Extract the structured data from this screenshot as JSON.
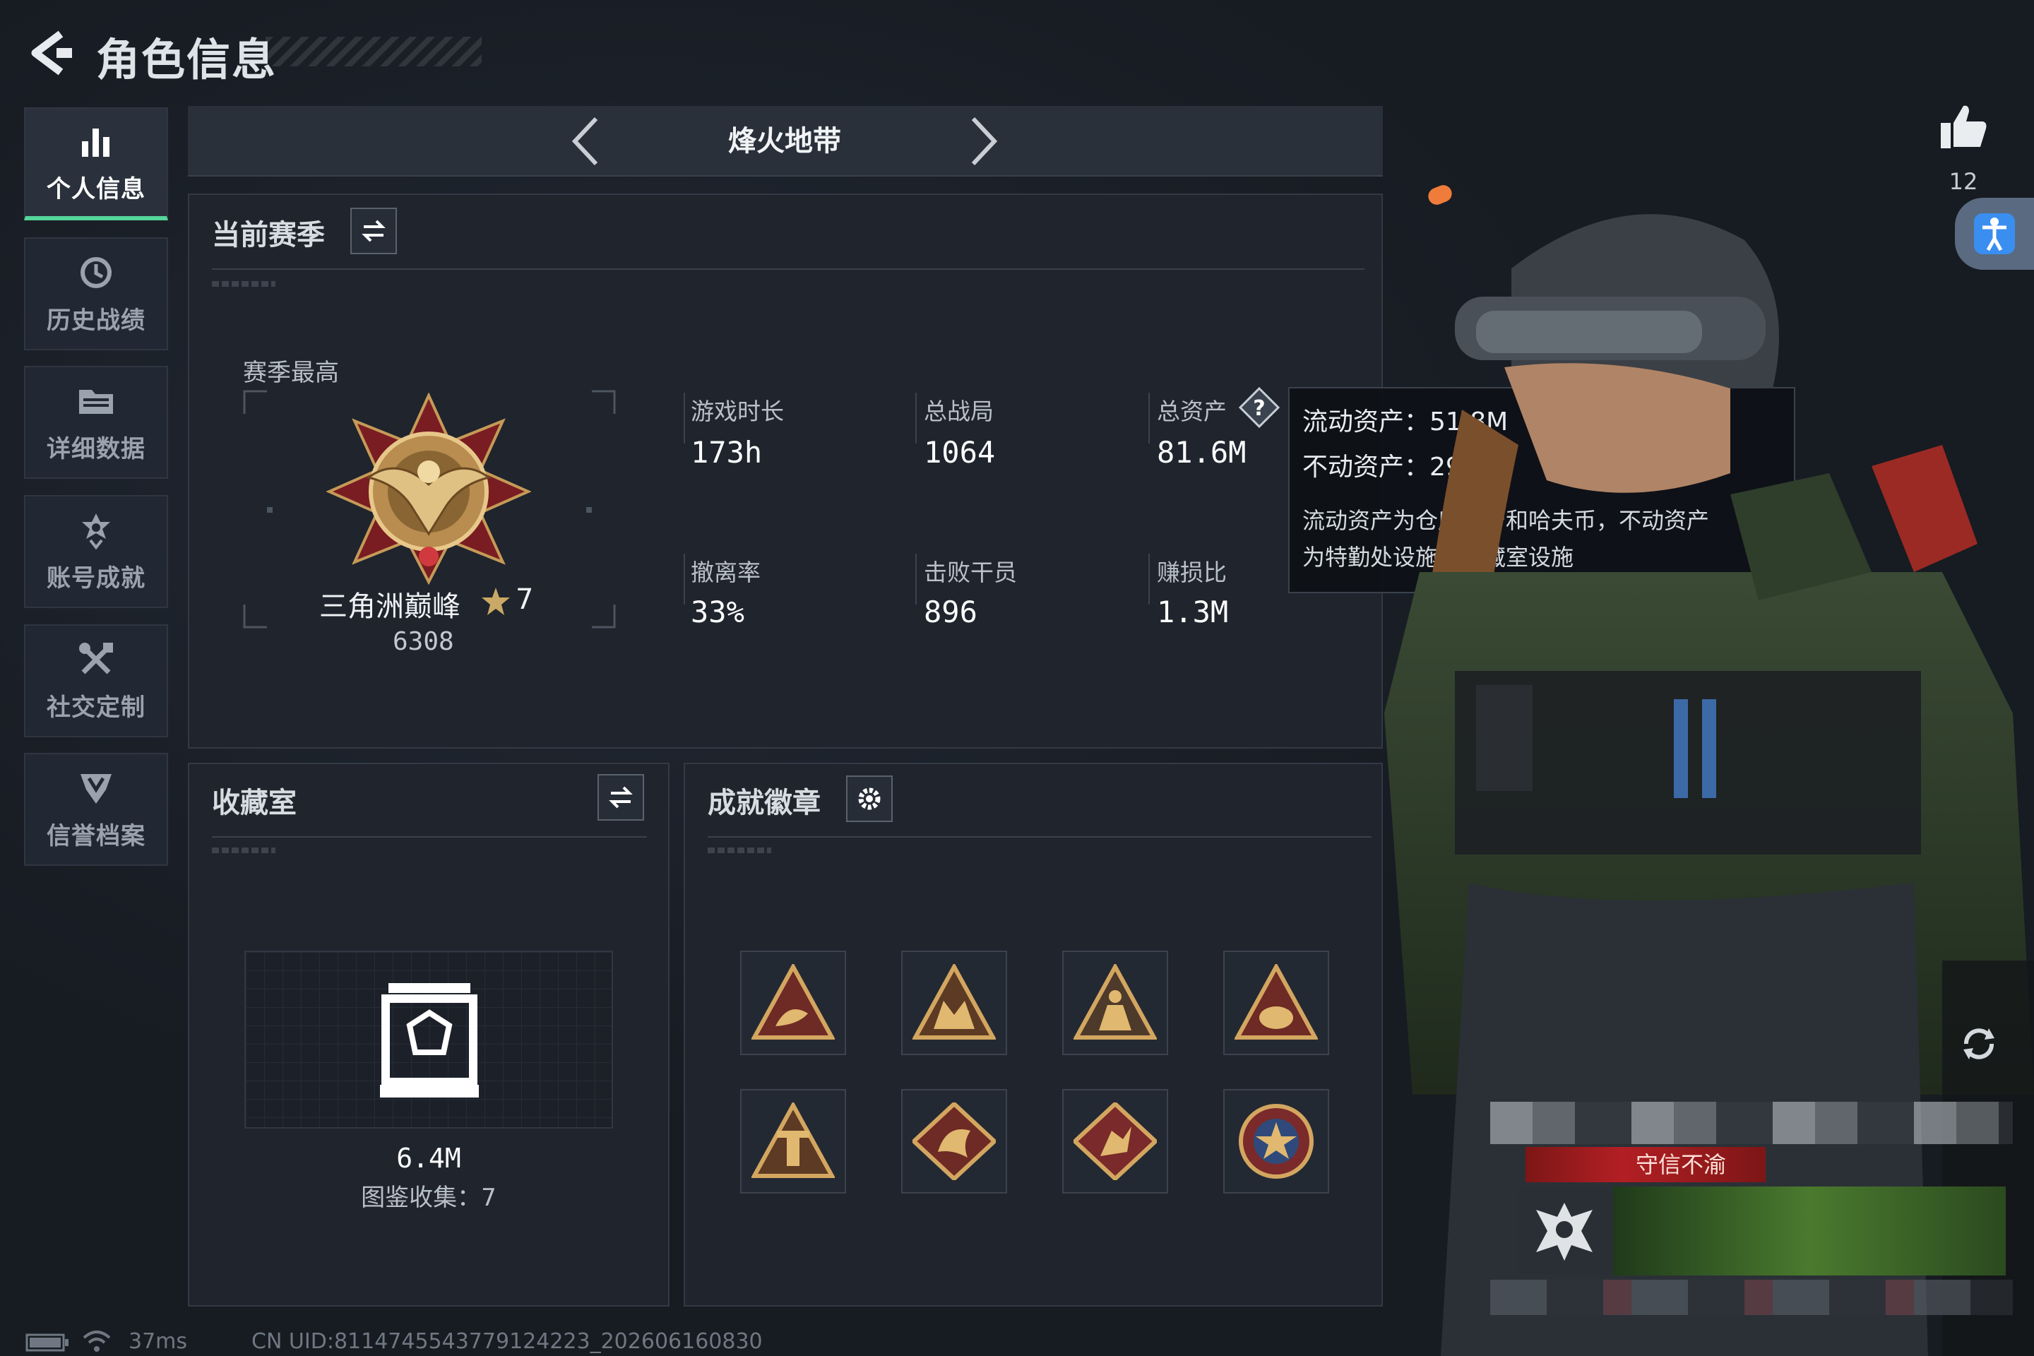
{
  "header": {
    "title": "角色信息"
  },
  "sidebar": {
    "items": [
      {
        "label": "个人信息",
        "icon": "bar-chart-icon",
        "active": true
      },
      {
        "label": "历史战绩",
        "icon": "history-icon"
      },
      {
        "label": "详细数据",
        "icon": "folder-icon"
      },
      {
        "label": "账号成就",
        "icon": "achievement-icon"
      },
      {
        "label": "社交定制",
        "icon": "tools-icon"
      },
      {
        "label": "信誉档案",
        "icon": "shield-icon"
      }
    ]
  },
  "mode": {
    "label": "烽火地带"
  },
  "season": {
    "title": "当前赛季",
    "best_label": "赛季最高",
    "rank_name": "三角洲巅峰",
    "rank_stars": "7",
    "rank_score": "6308",
    "stats": [
      {
        "label": "游戏时长",
        "value": "173h"
      },
      {
        "label": "总战局",
        "value": "1064"
      },
      {
        "label": "总资产",
        "value": "81.6M"
      },
      {
        "label": "撤离率",
        "value": "33%"
      },
      {
        "label": "击败干员",
        "value": "896"
      },
      {
        "label": "赚损比",
        "value": "1.3M"
      }
    ]
  },
  "tooltip": {
    "liquid": "流动资产：51.8M",
    "fixed": "不动资产：29.8M",
    "desc_line1": "流动资产为仓库资产和哈夫币，不动资产",
    "desc_line2": "为特勤处设施和收藏室设施"
  },
  "collection": {
    "title": "收藏室",
    "value": "6.4M",
    "count": "图鉴收集：7"
  },
  "badges": {
    "title": "成就徽章"
  },
  "likes": {
    "count": "12"
  },
  "character": {
    "title_tag": "守信不渝"
  },
  "footer": {
    "ping": "37ms",
    "uid": "CN UID:8114745543779124223_202606160830"
  },
  "colors": {
    "accent": "#55d69a",
    "tag_red": "#b21f24",
    "bg": "#1b2029"
  }
}
